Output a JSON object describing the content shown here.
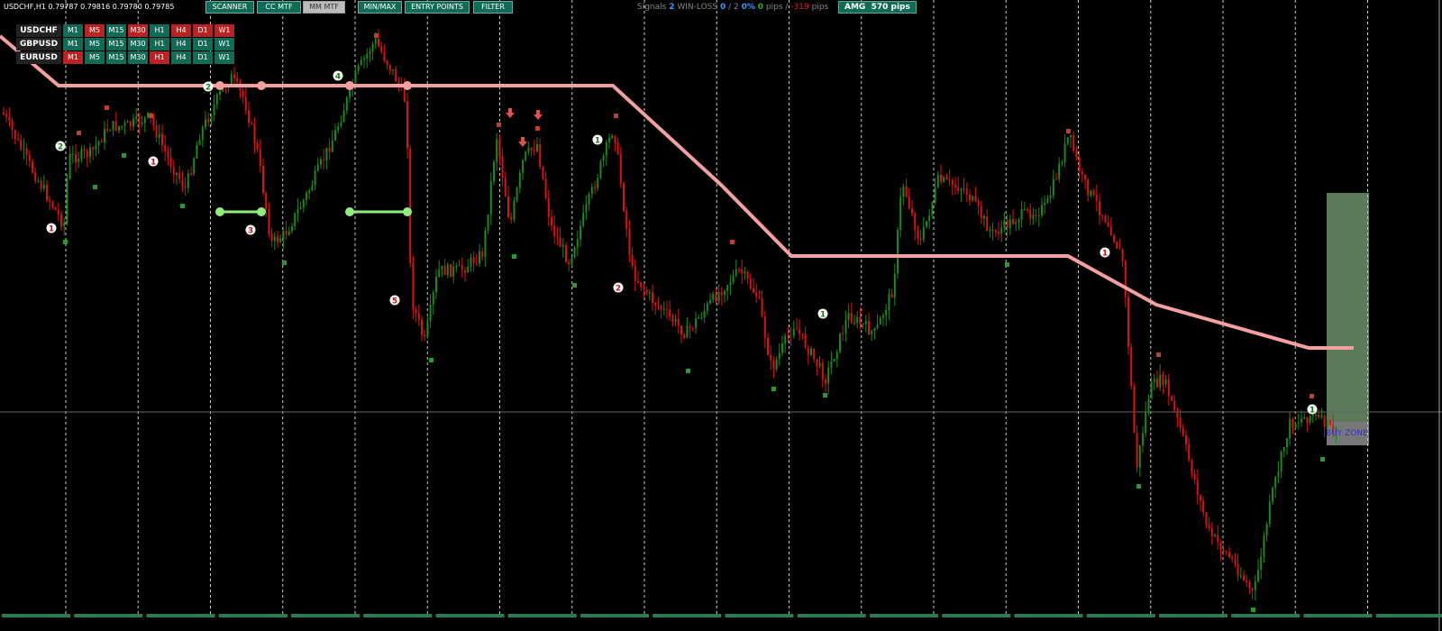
{
  "header": {
    "symbol_title": "USDCHF,H1  0.79787 0.79816 0.79780 0.79785"
  },
  "toolbar": [
    {
      "label": "SCANNER",
      "state": "on"
    },
    {
      "label": "CC MTF",
      "state": "on"
    },
    {
      "label": "MM MTF",
      "state": "off"
    },
    {
      "label": "MIN/MAX",
      "state": "on"
    },
    {
      "label": "ENTRY POINTS",
      "state": "on"
    },
    {
      "label": "FILTER",
      "state": "on"
    }
  ],
  "mtf": {
    "rows": [
      {
        "symbol": "USDCHF",
        "tfs": [
          [
            "M1",
            "up"
          ],
          [
            "M5",
            "down"
          ],
          [
            "M15",
            "up"
          ],
          [
            "M30",
            "down"
          ],
          [
            "H1",
            "up"
          ],
          [
            "H4",
            "down"
          ],
          [
            "D1",
            "down"
          ],
          [
            "W1",
            "down"
          ]
        ]
      },
      {
        "symbol": "GBPUSD",
        "tfs": [
          [
            "M1",
            "up"
          ],
          [
            "M5",
            "up"
          ],
          [
            "M15",
            "up"
          ],
          [
            "M30",
            "up"
          ],
          [
            "H1",
            "up"
          ],
          [
            "H4",
            "up"
          ],
          [
            "D1",
            "up"
          ],
          [
            "W1",
            "up"
          ]
        ]
      },
      {
        "symbol": "EURUSD",
        "tfs": [
          [
            "M1",
            "down"
          ],
          [
            "M5",
            "up"
          ],
          [
            "M15",
            "up"
          ],
          [
            "M30",
            "up"
          ],
          [
            "H1",
            "down"
          ],
          [
            "H4",
            "up"
          ],
          [
            "D1",
            "up"
          ],
          [
            "W1",
            "up"
          ]
        ]
      }
    ]
  },
  "stats": {
    "signals_label": "Signals",
    "signals": "2",
    "winloss_label": "WIN-LOSS",
    "wins": "0",
    "losses": "/ 2",
    "percent": "0%",
    "pips_win": "0",
    "pips_sep": "pips /",
    "pips_loss": "-319",
    "pips_unit": "pips"
  },
  "amg": {
    "label": "AMG",
    "value": "570 pips"
  },
  "buy_zone": {
    "label": "BUY ZONE"
  },
  "markers": [
    {
      "n": "1",
      "type": "sell"
    },
    {
      "n": "1",
      "type": "sell"
    },
    {
      "n": "3",
      "type": "sell"
    },
    {
      "n": "5",
      "type": "sell"
    },
    {
      "n": "2",
      "type": "sell"
    },
    {
      "n": "1",
      "type": "sell"
    },
    {
      "n": "2",
      "type": "buy"
    },
    {
      "n": "2",
      "type": "buy"
    },
    {
      "n": "4",
      "type": "buy"
    },
    {
      "n": "1",
      "type": "buy"
    },
    {
      "n": "1",
      "type": "buy"
    },
    {
      "n": "1",
      "type": "buy"
    }
  ],
  "colors": {
    "bull": "#1a8a1a",
    "bear": "#e01010",
    "trend": "#f4a0a0",
    "level": "#90ee80",
    "zone": "#5a7a5a",
    "button": "#126b56",
    "sell_tf": "#b22222"
  }
}
